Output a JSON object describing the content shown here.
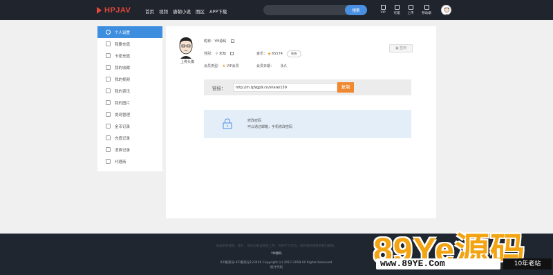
{
  "header": {
    "logo_text": "HPJAV",
    "nav": [
      "首页",
      "视频",
      "唐朝小说",
      "图区",
      "APP下载"
    ],
    "search": {
      "placeholder": "",
      "button": "搜索"
    },
    "tools": [
      "VIP",
      "代理",
      "上传",
      "移动端"
    ]
  },
  "sidebar": {
    "items": [
      {
        "label": "个人设置",
        "icon": "user-icon",
        "active": true
      },
      {
        "label": "我要充值",
        "icon": "recharge-icon",
        "active": false
      },
      {
        "label": "卡密充值",
        "icon": "card-icon",
        "active": false
      },
      {
        "label": "我的收藏",
        "icon": "star-icon",
        "active": false
      },
      {
        "label": "我的视频",
        "icon": "video-icon",
        "active": false
      },
      {
        "label": "我的资讯",
        "icon": "news-icon",
        "active": false
      },
      {
        "label": "我的图片",
        "icon": "image-icon",
        "active": false
      },
      {
        "label": "提现管理",
        "icon": "withdraw-icon",
        "active": false
      },
      {
        "label": "金币记录",
        "icon": "coin-icon",
        "active": false
      },
      {
        "label": "充值记录",
        "icon": "recharge-record-icon",
        "active": false
      },
      {
        "label": "消费记录",
        "icon": "consume-icon",
        "active": false
      },
      {
        "label": "代理商",
        "icon": "agent-icon",
        "active": false
      }
    ]
  },
  "profile": {
    "upload_label": "上传头像",
    "nickname": "昵称：YM源码",
    "gender": "性别：",
    "gender_value": "未知",
    "coins_label": "金币：",
    "coins_value": "65574",
    "recharge": "充值",
    "member_type_label": "会员类型：",
    "member_type_value": "VIP会员",
    "expire_label": "会员日期：",
    "expire_value": "永久",
    "sign_button": "签到"
  },
  "share": {
    "label": "链接：",
    "url": "http://m.tp9gp9.cn/share/159",
    "copy": "复制"
  },
  "password": {
    "title": "修改密码",
    "desc": "可以通过邮箱，手机修改密码"
  },
  "footer": {
    "notice": "本站所有视频、图片、资讯均来自网友上传，仅供学习交流，如有侵权请联系我们删除。",
    "site": "YM源码",
    "icp": "ICP备案号:ICP备案号123456   Copyright (c) 2017-2018 All Rights Reserved.",
    "stats": "统计代码"
  },
  "watermark": {
    "big": "89Ye源码",
    "url": "www.89YE.Com",
    "tag": "10年老站"
  },
  "colors": {
    "header_bg": "#20242d",
    "accent": "#3e8ee0",
    "copy_button": "#f0882f",
    "logo": "#e8473a",
    "watermark": "#f2a413"
  }
}
